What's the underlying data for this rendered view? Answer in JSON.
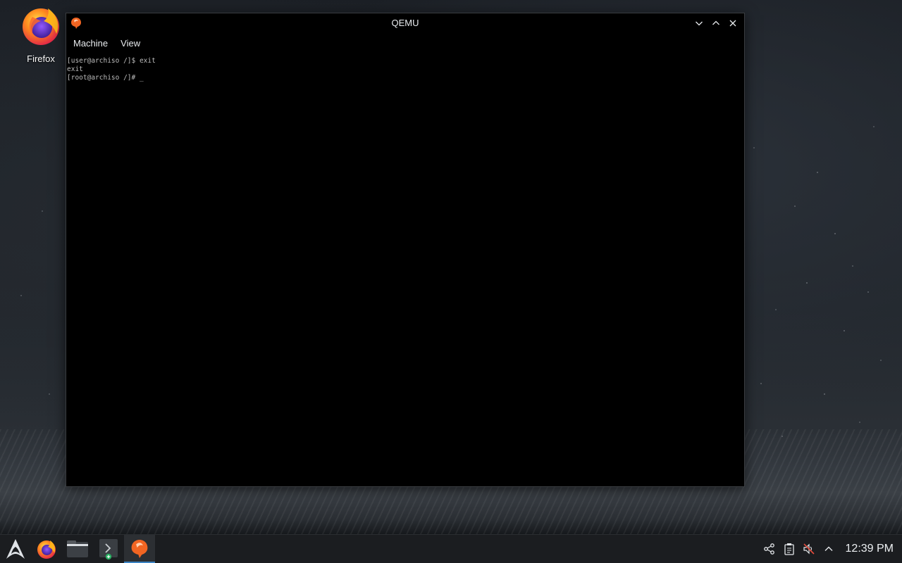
{
  "desktop": {
    "icons": [
      {
        "label": "Firefox",
        "icon": "firefox-icon"
      }
    ]
  },
  "window": {
    "title": "QEMU",
    "app_icon": "qemu-icon",
    "controls": [
      "minimize-icon",
      "maximize-icon",
      "close-icon"
    ],
    "menus": [
      {
        "label": "Machine"
      },
      {
        "label": "View"
      }
    ],
    "console_lines": [
      "[user@archiso /]$ exit",
      "exit",
      "[root@archiso /]# _"
    ]
  },
  "taskbar": {
    "launcher_icon": "arch-launcher-icon",
    "items": [
      {
        "icon": "firefox-icon"
      },
      {
        "icon": "file-manager-icon"
      },
      {
        "icon": "terminal-icon"
      },
      {
        "icon": "qemu-icon",
        "active": true
      }
    ],
    "tray": [
      "network-icon",
      "clipboard-icon",
      "volume-muted-icon",
      "chevron-up-icon"
    ],
    "clock": "12:39 PM"
  },
  "colors": {
    "accent": "#3b84c4",
    "qemu_orange": "#f26522",
    "taskbar_bg": "#1b1d20"
  }
}
